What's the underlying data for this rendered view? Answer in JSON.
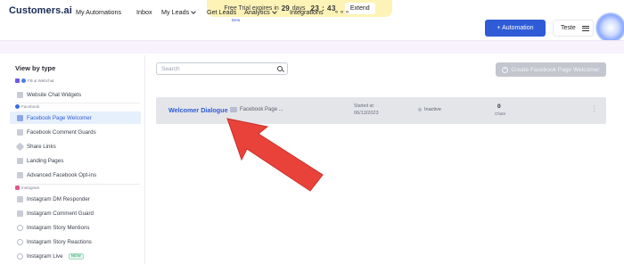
{
  "trial": {
    "prefix": "Free Trial expires in",
    "days": "29",
    "days_label": "days",
    "timer": "23 : 43",
    "extend_label": "Extend"
  },
  "header": {
    "logo": "Customers.ai",
    "nav": [
      "My Automations",
      "Inbox",
      "My Leads",
      "Get Leads",
      "Analytics",
      "Integrations"
    ],
    "beta": "Beta",
    "automation_button": "+ Automation",
    "user_label": "Teste"
  },
  "sidebar": {
    "title": "View by type",
    "groups": {
      "webchat": "FB & Webchat",
      "facebook": "Facebook",
      "instagram": "Instagram"
    },
    "items": [
      {
        "label": "Website Chat Widgets"
      },
      {
        "label": "Facebook Page Welcomer"
      },
      {
        "label": "Facebook Comment Guards"
      },
      {
        "label": "Share Links"
      },
      {
        "label": "Landing Pages"
      },
      {
        "label": "Advanced Facebook Opt-ins"
      },
      {
        "label": "Instagram DM Responder"
      },
      {
        "label": "Instagram Comment Guard"
      },
      {
        "label": "Instagram Story Mentions"
      },
      {
        "label": "Instagram Story Reactions"
      },
      {
        "label": "Instagram Live",
        "badge": "NEW"
      }
    ]
  },
  "main": {
    "search_placeholder": "Search",
    "create_button": "Create Facebook Page Welcomer",
    "row": {
      "name": "Welcomer Dialogue",
      "type": "Facebook Page ...",
      "started_label": "Started at:",
      "started_value": "06/13/2023",
      "status": "Inactive",
      "chats_value": "0",
      "chats_label": "Chats"
    }
  },
  "colors": {
    "accent": "#2f5cd6",
    "active_bg": "#e6f0fc",
    "arrow": "#e8423a",
    "trial_bg": "#fdf3b7"
  }
}
